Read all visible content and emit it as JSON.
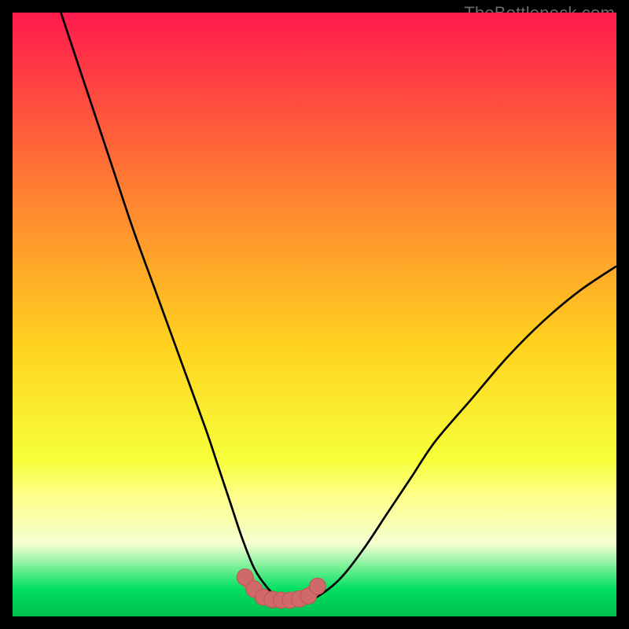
{
  "watermark": "TheBottleneck.com",
  "colors": {
    "black": "#000000",
    "curve": "#000000",
    "marker_fill": "#d06a6a",
    "marker_stroke": "#c35555",
    "gradient_top": "#ff1a4d",
    "gradient_upper_mid": "#ff7a33",
    "gradient_mid": "#ffd21f",
    "gradient_lower_mid": "#f6ff3a",
    "gradient_yellow_band": "#ffff8a",
    "gradient_pale": "#f4ffd0",
    "gradient_green": "#00e060",
    "gradient_green_deep": "#00c050"
  },
  "chart_data": {
    "type": "line",
    "title": "",
    "xlabel": "",
    "ylabel": "",
    "xlim": [
      0,
      100
    ],
    "ylim": [
      0,
      100
    ],
    "note": "Axes are unlabeled; x and y values estimated from pixel positions on a 0–100 normalized scale.",
    "series": [
      {
        "name": "bottleneck-curve",
        "x": [
          8,
          12,
          16,
          20,
          24,
          28,
          32,
          34,
          36,
          38,
          40,
          42,
          44,
          46,
          48,
          50,
          54,
          58,
          62,
          66,
          70,
          76,
          82,
          88,
          94,
          100
        ],
        "y": [
          100,
          88,
          76,
          64,
          53,
          42,
          31,
          25,
          19,
          13,
          8,
          5,
          3,
          2.7,
          2.7,
          3,
          6,
          11,
          17,
          23,
          29,
          36,
          43,
          49,
          54,
          58
        ]
      }
    ],
    "markers": {
      "name": "highlight-band",
      "x": [
        38.5,
        40,
        41.5,
        43,
        44.5,
        46,
        47.5,
        49,
        50.5
      ],
      "y": [
        6.5,
        4.5,
        3.2,
        2.8,
        2.7,
        2.7,
        2.9,
        3.4,
        5.0
      ]
    },
    "background_gradient_stops": [
      {
        "offset": 0.0,
        "color": "#ff1a4d"
      },
      {
        "offset": 0.28,
        "color": "#ff7a33"
      },
      {
        "offset": 0.55,
        "color": "#ffd21f"
      },
      {
        "offset": 0.74,
        "color": "#f6ff3a"
      },
      {
        "offset": 0.8,
        "color": "#ffff8a"
      },
      {
        "offset": 0.88,
        "color": "#f4ffd0"
      },
      {
        "offset": 0.955,
        "color": "#00e060"
      },
      {
        "offset": 1.0,
        "color": "#00c050"
      }
    ]
  }
}
